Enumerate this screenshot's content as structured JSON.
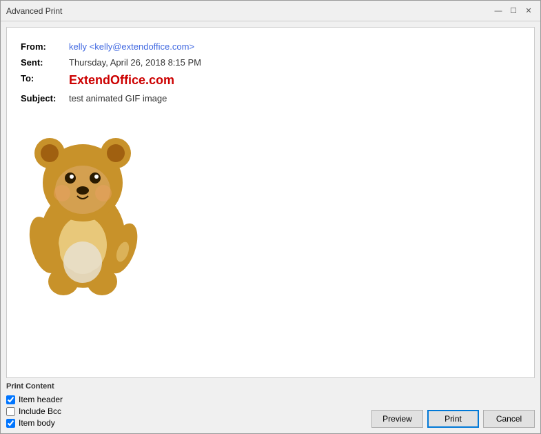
{
  "window": {
    "title": "Advanced Print"
  },
  "titlebar": {
    "minimize_label": "🗕",
    "maximize_label": "🗖",
    "close_label": "✕"
  },
  "email": {
    "from_label": "From:",
    "from_value": "kelly <kelly@extendoffice.com>",
    "sent_label": "Sent:",
    "sent_value": "Thursday, April 26, 2018 8:15 PM",
    "to_label": "To:",
    "to_value": "ExtendOffice.com",
    "subject_label": "Subject:",
    "subject_value": "test animated GIF image"
  },
  "print_content": {
    "section_label": "Print Content",
    "item_header_label": "Item header",
    "include_bcc_label": "Include Bcc",
    "item_body_label": "Item body",
    "item_header_checked": true,
    "include_bcc_checked": false,
    "item_body_checked": true
  },
  "buttons": {
    "preview_label": "Preview",
    "print_label": "Print",
    "cancel_label": "Cancel"
  }
}
